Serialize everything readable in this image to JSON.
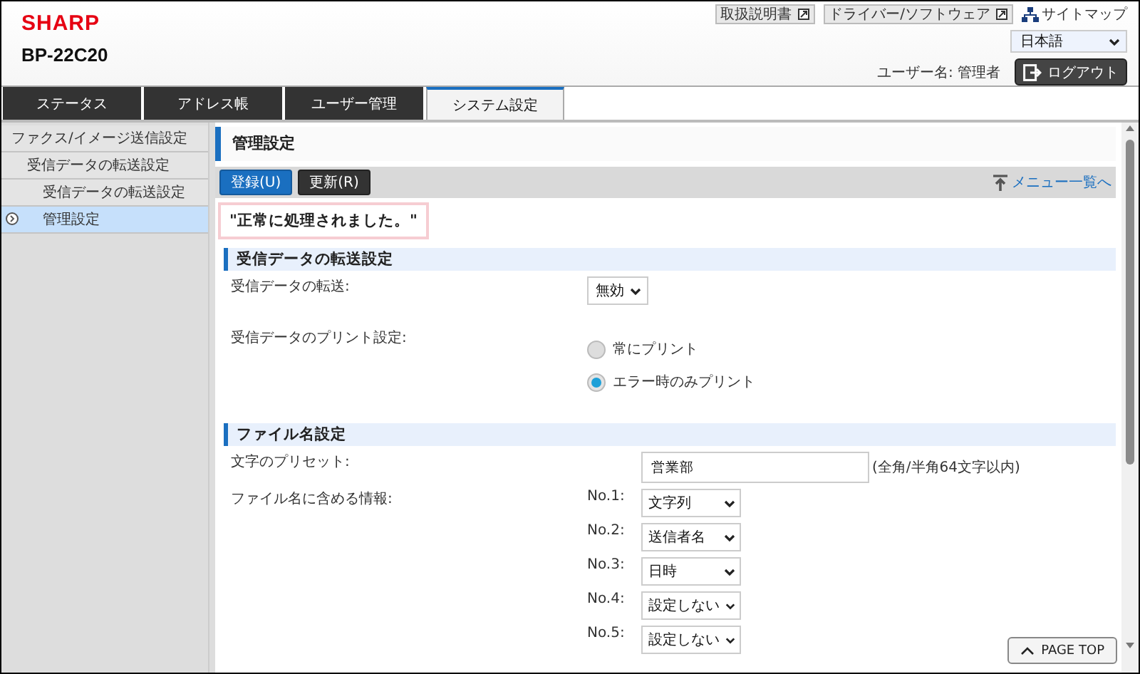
{
  "header": {
    "logo": "SHARP",
    "model": "BP-22C20",
    "links": [
      {
        "label": "取扱説明書"
      },
      {
        "label": "ドライバー/ソフトウェア"
      }
    ],
    "sitemap": "サイトマップ",
    "language": "日本語",
    "user": "ユーザー名: 管理者",
    "logout": "ログアウト"
  },
  "tabs": [
    {
      "label": "ステータス",
      "selected": false
    },
    {
      "label": "アドレス帳",
      "selected": false
    },
    {
      "label": "ユーザー管理",
      "selected": false
    },
    {
      "label": "システム設定",
      "selected": true
    }
  ],
  "sidebar": {
    "items": [
      {
        "label": "ファクス/イメージ送信設定",
        "selected": false,
        "children": [
          {
            "label": "受信データの転送設定",
            "selected": false,
            "children": [
              {
                "label": "受信データの転送設定",
                "selected": false
              },
              {
                "label": "管理設定",
                "selected": true
              }
            ]
          }
        ]
      }
    ]
  },
  "page": {
    "title": "管理設定",
    "buttons": [
      {
        "label": "登録(U)",
        "kind": "primary"
      },
      {
        "label": "更新(R)",
        "kind": "secondary"
      }
    ],
    "menu_link": "メニュー一覧へ",
    "message": "\"正常に処理されました。\"",
    "sections": [
      {
        "title": "受信データの転送設定",
        "rows": [
          {
            "kind": "select",
            "label": "受信データの転送:",
            "value": "無効"
          },
          {
            "kind": "radio",
            "label": "受信データのプリント設定:",
            "options": [
              {
                "label": "常にプリント",
                "selected": false
              },
              {
                "label": "エラー時のみプリント",
                "selected": true
              }
            ]
          }
        ]
      },
      {
        "title": "ファイル名設定",
        "rows": [
          {
            "kind": "text",
            "label": "文字のプリセット:",
            "value": "営業部",
            "note": "(全角/半角64文字以内)"
          },
          {
            "kind": "selects",
            "label": "ファイル名に含める情報:",
            "items": [
              {
                "label": "No.1:",
                "value": "文字列"
              },
              {
                "label": "No.2:",
                "value": "送信者名"
              },
              {
                "label": "No.3:",
                "value": "日時"
              },
              {
                "label": "No.4:",
                "value": "設定しない"
              },
              {
                "label": "No.5:",
                "value": "設定しない"
              }
            ]
          }
        ]
      }
    ],
    "page_top": "PAGE TOP"
  }
}
